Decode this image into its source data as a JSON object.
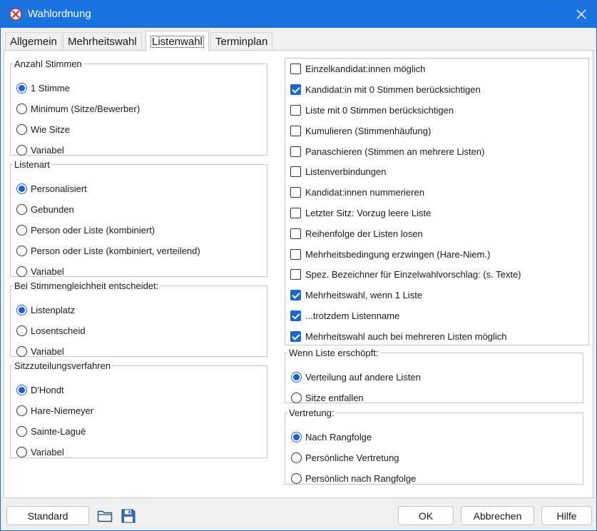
{
  "window": {
    "title": "Wahlordnung"
  },
  "tabs": [
    {
      "label": "Allgemein"
    },
    {
      "label": "Mehrheitswahl"
    },
    {
      "label": "Listenwahl"
    },
    {
      "label": "Terminplan"
    }
  ],
  "groups": {
    "anzahl": {
      "legend": "Anzahl Stimmen",
      "options": [
        {
          "label": "1 Stimme",
          "checked": true
        },
        {
          "label": "Minimum (Sitze/Bewerber)",
          "checked": false
        },
        {
          "label": "Wie Sitze",
          "checked": false
        },
        {
          "label": "Variabel",
          "checked": false
        }
      ]
    },
    "listenart": {
      "legend": "Listenart",
      "options": [
        {
          "label": "Personalisiert",
          "checked": true
        },
        {
          "label": "Gebunden",
          "checked": false
        },
        {
          "label": "Person oder Liste (kombiniert)",
          "checked": false
        },
        {
          "label": "Person oder Liste (kombiniert, verteilend)",
          "checked": false
        },
        {
          "label": "Variabel",
          "checked": false
        }
      ]
    },
    "gleichheit": {
      "legend": "Bei Stimmengleichheit entscheidet:",
      "options": [
        {
          "label": "Listenplatz",
          "checked": true
        },
        {
          "label": "Losentscheid",
          "checked": false
        },
        {
          "label": "Variabel",
          "checked": false
        }
      ]
    },
    "sitz": {
      "legend": "Sitzzuteilungsverfahren",
      "options": [
        {
          "label": "D'Hondt",
          "checked": true
        },
        {
          "label": "Hare-Niemeyer",
          "checked": false
        },
        {
          "label": "Sainte-Laguë",
          "checked": false
        },
        {
          "label": "Variabel",
          "checked": false
        }
      ]
    },
    "erschoepft": {
      "legend": "Wenn Liste erschöpft:",
      "options": [
        {
          "label": "Verteilung auf andere Listen",
          "checked": true
        },
        {
          "label": "Sitze entfallen",
          "checked": false
        }
      ]
    },
    "vertretung": {
      "legend": "Vertretung:",
      "options": [
        {
          "label": "Nach Rangfolge",
          "checked": true
        },
        {
          "label": "Persönliche Vertretung",
          "checked": false
        },
        {
          "label": "Persönlich nach Rangfolge",
          "checked": false
        }
      ]
    }
  },
  "checkboxes": [
    {
      "label": "Einzelkandidat:innen möglich",
      "checked": false
    },
    {
      "label": "Kandidat:in mit 0 Stimmen berücksichtigen",
      "checked": true
    },
    {
      "label": "Liste mit 0 Stimmen berücksichtigen",
      "checked": false
    },
    {
      "label": "Kumulieren (Stimmenhäufung)",
      "checked": false
    },
    {
      "label": "Panaschieren (Stimmen an mehrere Listen)",
      "checked": false
    },
    {
      "label": "Listenverbindungen",
      "checked": false
    },
    {
      "label": "Kandidat:innen nummerieren",
      "checked": false
    },
    {
      "label": "Letzter Sitz: Vorzug leere Liste",
      "checked": false
    },
    {
      "label": "Reihenfolge der Listen losen",
      "checked": false
    },
    {
      "label": "Mehrheitsbedingung erzwingen (Hare-Niem.)",
      "checked": false
    },
    {
      "label": "Spez. Bezeichner für Einzelwahlvorschlag: (s. Texte)",
      "checked": false
    },
    {
      "label": "Mehrheitswahl, wenn 1 Liste",
      "checked": true
    },
    {
      "label": "...trotzdem Listenname",
      "checked": true
    },
    {
      "label": "Mehrheitswahl auch bei mehreren Listen möglich",
      "checked": true
    }
  ],
  "buttons": {
    "standard": "Standard",
    "ok": "OK",
    "abbrechen": "Abbrechen",
    "hilfe": "Hilfe"
  },
  "icons": {
    "app": "ballot-x-icon",
    "open": "folder-icon",
    "save": "floppy-disk-icon"
  },
  "colors": {
    "titlebar": "#1a73e0",
    "accent": "#1a66d6",
    "app_icon": "#c8332e"
  }
}
